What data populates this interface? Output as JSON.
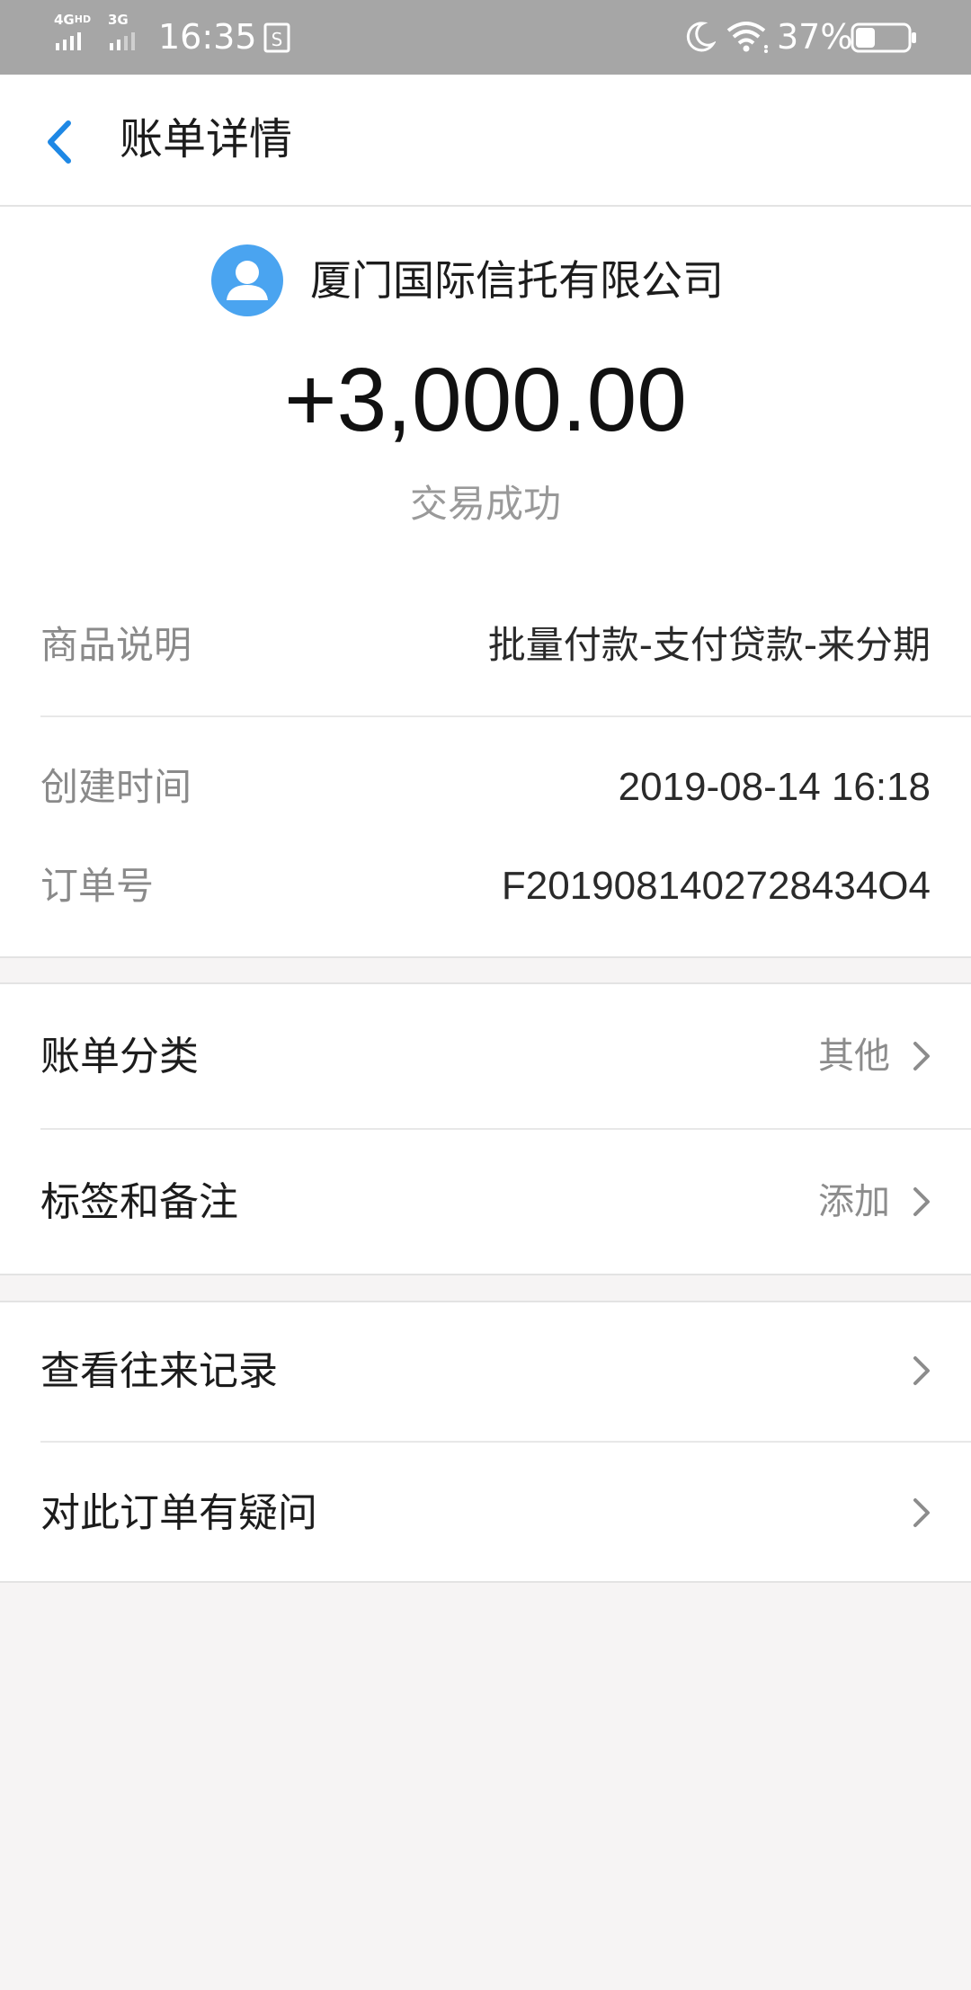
{
  "status_bar": {
    "network1": "4G",
    "network1_sup": "HD",
    "network2": "3G",
    "time": "16:35",
    "battery": "37%",
    "battery_level": 0.37
  },
  "header": {
    "title": "账单详情",
    "back_icon": "chevron-left-icon"
  },
  "summary": {
    "payee_name": "厦门国际信托有限公司",
    "avatar_icon": "user-avatar-icon",
    "amount": "+3,000.00",
    "status": "交易成功"
  },
  "details": [
    {
      "label": "商品说明",
      "value": "批量付款-支付贷款-来分期"
    },
    {
      "label": "创建时间",
      "value": "2019-08-14 16:18"
    },
    {
      "label": "订单号",
      "value": "F2019081402728434O4"
    }
  ],
  "settings": [
    {
      "label": "账单分类",
      "value": "其他"
    },
    {
      "label": "标签和备注",
      "value": "添加"
    }
  ],
  "actions": [
    {
      "label": "查看往来记录"
    },
    {
      "label": "对此订单有疑问"
    }
  ],
  "colors": {
    "status_bar": "#a6a6a6",
    "accent": "#1e88e5",
    "avatar": "#4aa4f0",
    "page_bg": "#f6f4f4"
  }
}
